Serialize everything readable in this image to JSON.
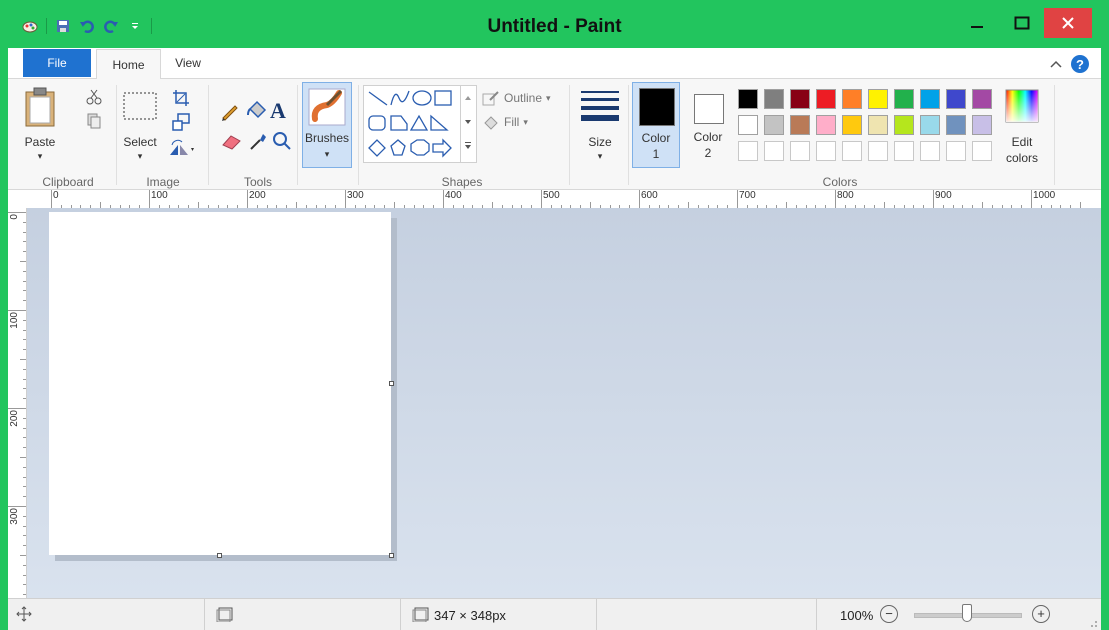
{
  "window": {
    "title": "Untitled - Paint",
    "close_glyph": "✕",
    "min_glyph": "—",
    "max_glyph": "☐"
  },
  "tabs": {
    "file": "File",
    "home": "Home",
    "view": "View",
    "help_glyph": "?"
  },
  "ribbon": {
    "clipboard": {
      "group": "Clipboard",
      "paste": "Paste",
      "arrow": "▾"
    },
    "image": {
      "group": "Image",
      "select": "Select",
      "arrow": "▾"
    },
    "tools": {
      "group": "Tools",
      "text_glyph": "A"
    },
    "brushes": {
      "label": "Brushes",
      "arrow": "▾"
    },
    "shapes": {
      "group": "Shapes",
      "outline": "Outline",
      "fill": "Fill",
      "caret": "▾"
    },
    "size": {
      "label": "Size",
      "arrow": "▾"
    },
    "color1": {
      "line1": "Color",
      "line2": "1",
      "value": "#000000"
    },
    "color2": {
      "line1": "Color",
      "line2": "2",
      "value": "#ffffff"
    },
    "colors": {
      "group": "Colors",
      "edit_line1": "Edit",
      "edit_line2": "colors",
      "row1": [
        "#000000",
        "#7f7f7f",
        "#880015",
        "#ed1c24",
        "#ff7f27",
        "#fff200",
        "#22b14c",
        "#00a2e8",
        "#3f48cc",
        "#a349a4"
      ],
      "row2": [
        "#ffffff",
        "#c3c3c3",
        "#b97a57",
        "#ffaec9",
        "#ffc90e",
        "#efe4b0",
        "#b5e61d",
        "#99d9ea",
        "#7092be",
        "#c8bfe7"
      ]
    }
  },
  "rulers": {
    "h": [
      "0",
      "100",
      "200",
      "300",
      "400",
      "500",
      "600",
      "700",
      "800",
      "900",
      "1000"
    ],
    "v": [
      "0",
      "100",
      "200",
      "300"
    ]
  },
  "status": {
    "size": "347 × 348px",
    "zoom": "100%",
    "zoom_out": "−",
    "zoom_in": "+",
    "zoom_fraction": 0.5
  },
  "icons": {
    "app": "paint-app-icon",
    "save": "save-icon",
    "undo": "undo-icon",
    "redo": "redo-icon"
  }
}
